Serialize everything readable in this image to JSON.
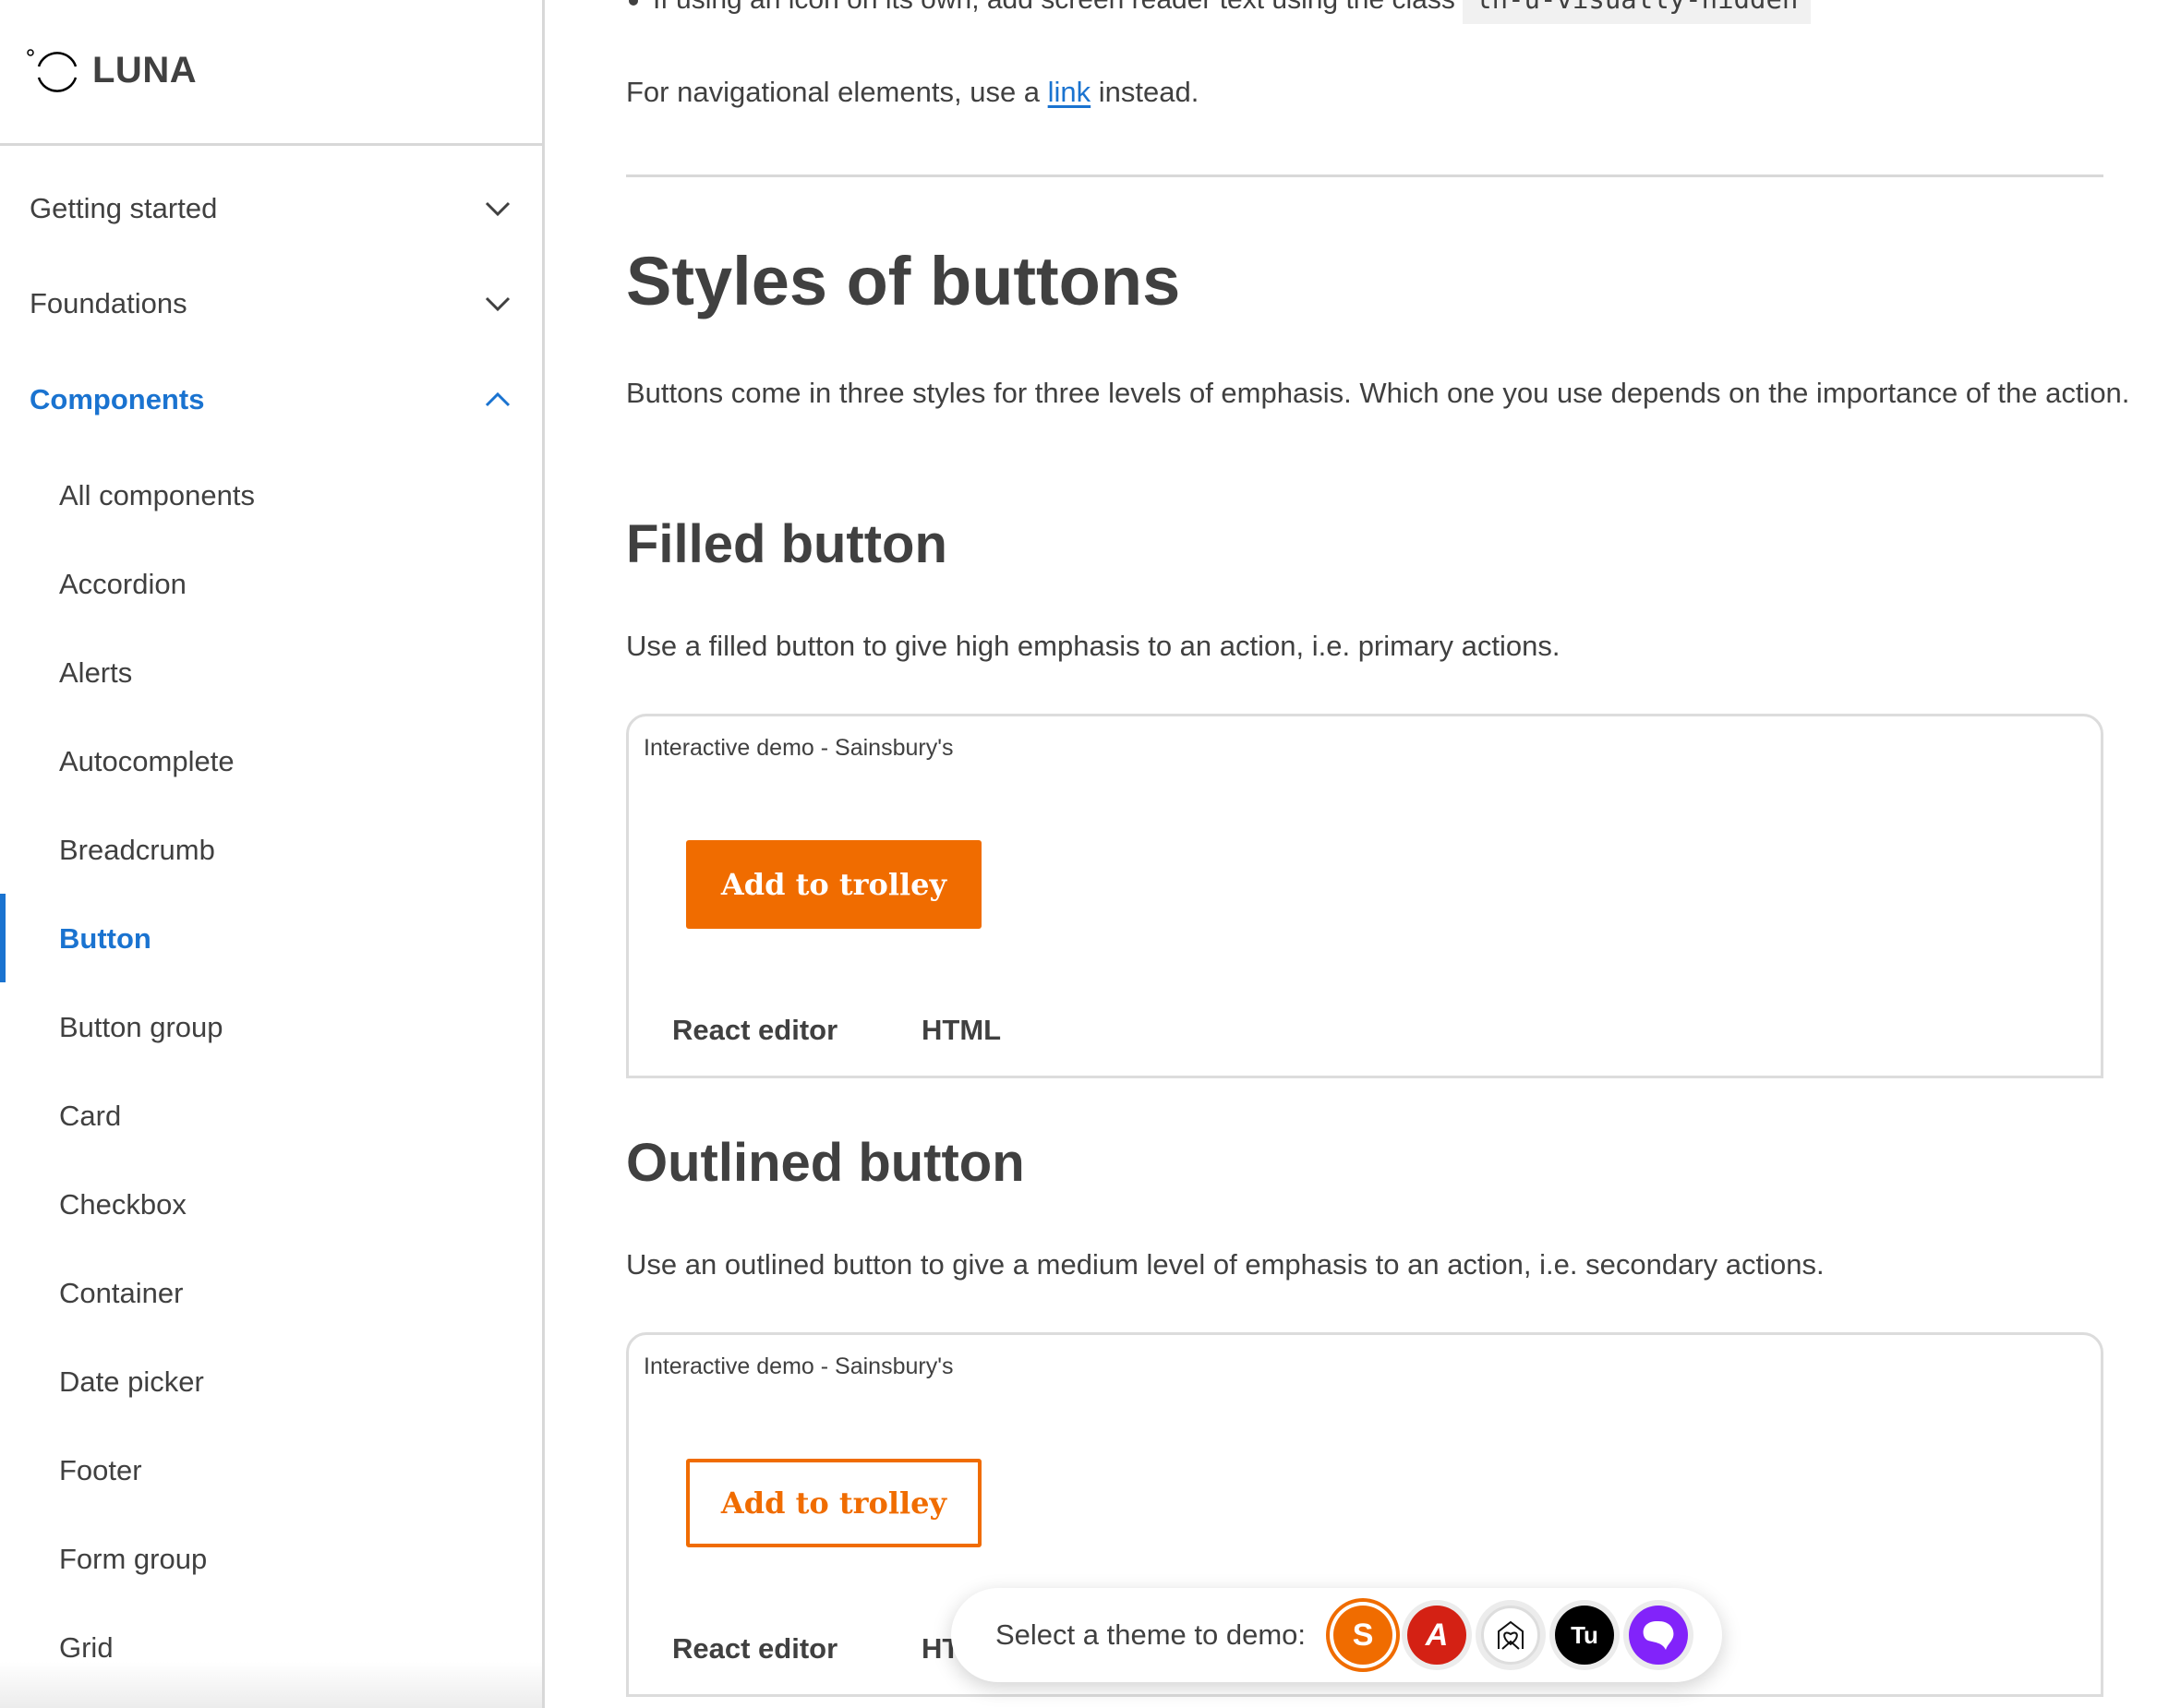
{
  "brand": {
    "name": "LUNA"
  },
  "sidebar": {
    "sections": [
      {
        "label": "Getting started",
        "expanded": false
      },
      {
        "label": "Foundations",
        "expanded": false
      },
      {
        "label": "Components",
        "expanded": true
      }
    ],
    "components": [
      {
        "label": "All components"
      },
      {
        "label": "Accordion"
      },
      {
        "label": "Alerts"
      },
      {
        "label": "Autocomplete"
      },
      {
        "label": "Breadcrumb"
      },
      {
        "label": "Button",
        "active": true
      },
      {
        "label": "Button group"
      },
      {
        "label": "Card"
      },
      {
        "label": "Checkbox"
      },
      {
        "label": "Container"
      },
      {
        "label": "Date picker"
      },
      {
        "label": "Footer"
      },
      {
        "label": "Form group"
      },
      {
        "label": "Grid"
      }
    ]
  },
  "main": {
    "bullet_text": "If using an icon on its own, add screen reader text using the class",
    "bullet_code": "ln-u-visually-hidden",
    "nav_para_before": "For navigational elements, use a ",
    "nav_para_link": "link",
    "nav_para_after": " instead.",
    "title": "Styles of buttons",
    "intro": "Buttons come in three styles for three levels of emphasis. Which one you use depends on the importance of the action.",
    "sections": [
      {
        "heading": "Filled button",
        "description": "Use a filled button to give high emphasis to an action, i.e. primary actions.",
        "demo_label": "Interactive demo - Sainsbury's",
        "button_label": "Add to trolley",
        "tabs": [
          "React editor",
          "HTML"
        ]
      },
      {
        "heading": "Outlined button",
        "description": "Use an outlined button to give a medium level of emphasis to an action, i.e. secondary actions.",
        "demo_label": "Interactive demo - Sainsbury's",
        "button_label": "Add to trolley",
        "tabs": [
          "React editor",
          "HTML"
        ]
      }
    ]
  },
  "theme_picker": {
    "label": "Select a theme to demo:",
    "themes": [
      {
        "name": "Sainsbury's",
        "glyph": "S",
        "color": "#f06c00",
        "selected": true
      },
      {
        "name": "Argos",
        "glyph": "A",
        "color": "#d42114",
        "selected": false
      },
      {
        "name": "Habitat",
        "glyph": "home-heart",
        "color": "#ffffff",
        "selected": false
      },
      {
        "name": "Tu",
        "glyph": "Tu",
        "color": "#000000",
        "selected": false
      },
      {
        "name": "Nectar",
        "glyph": "speech-bubble",
        "color": "#8223fa",
        "selected": false
      }
    ]
  },
  "colors": {
    "accent": "#1a73d0",
    "brand_orange": "#f06c00",
    "text": "#404040",
    "border": "#d8d8d8"
  }
}
